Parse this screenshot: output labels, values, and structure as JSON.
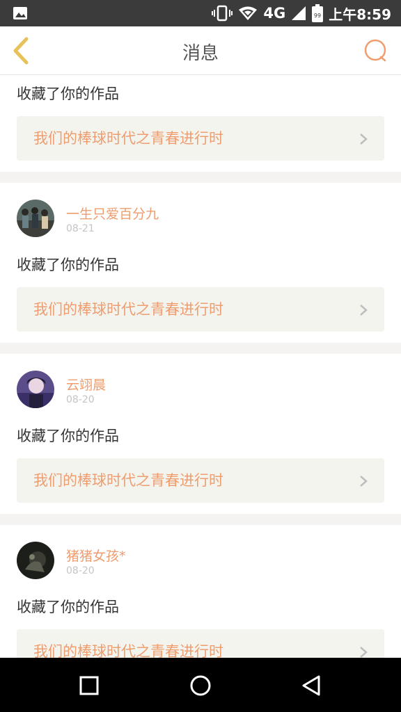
{
  "status_bar": {
    "network": "4G",
    "battery": "99",
    "time": "上午8:59",
    "icons": [
      "gallery-icon",
      "vibrate-icon",
      "wifi-icon",
      "signal-icon",
      "battery-icon"
    ]
  },
  "header": {
    "title": "消息",
    "back_icon": "chevron-left-icon",
    "action_icon": "chat-bubble-icon"
  },
  "colors": {
    "accent": "#ee9d6f",
    "back_icon": "#e7c25a",
    "card_bg": "#f4f4ef",
    "separator": "#f5f2f2"
  },
  "notifications": [
    {
      "user": "",
      "date": "",
      "action": "收藏了你的作品",
      "work": "我们的棒球时代之青春进行时"
    },
    {
      "user": "一生只爱百分九",
      "date": "08-21",
      "action": "收藏了你的作品",
      "work": "我们的棒球时代之青春进行时"
    },
    {
      "user": "云翊晨",
      "date": "08-20",
      "action": "收藏了你的作品",
      "work": "我们的棒球时代之青春进行时"
    },
    {
      "user": "猪猪女孩*",
      "date": "08-20",
      "action": "收藏了你的作品",
      "work": "我们的棒球时代之青春进行时"
    }
  ],
  "nav_bar": {
    "buttons": [
      "recents-icon",
      "home-icon",
      "back-icon"
    ]
  }
}
